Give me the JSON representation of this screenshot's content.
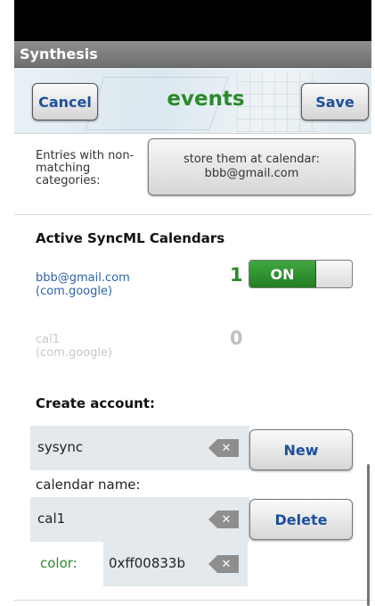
{
  "app": {
    "title": "Synthesis"
  },
  "header": {
    "cancel_label": "Cancel",
    "title": "events",
    "save_label": "Save"
  },
  "entries": {
    "label": "Entries with non-matching categories:",
    "button_line1": "store them at calendar:",
    "button_line2": "bbb@gmail.com"
  },
  "active_calendars": {
    "title": "Active SyncML Calendars",
    "items": [
      {
        "name": "bbb@gmail.com",
        "type": "(com.google)",
        "count": "1",
        "toggle": "ON",
        "enabled": true
      },
      {
        "name": "cal1",
        "type": "(com.google)",
        "count": "0",
        "enabled": false
      }
    ]
  },
  "create_account": {
    "title": "Create account:",
    "account_value": "sysync",
    "new_label": "New",
    "calendar_name_label": "calendar name:",
    "calendar_name_value": "cal1",
    "delete_label": "Delete",
    "color_label": "color:",
    "color_value": "0xff00833b",
    "clear_glyph": "✕"
  },
  "colors": {
    "accent_green": "#2b8a2b",
    "link_blue": "#2d64a8",
    "button_text": "#1c4f9c"
  }
}
